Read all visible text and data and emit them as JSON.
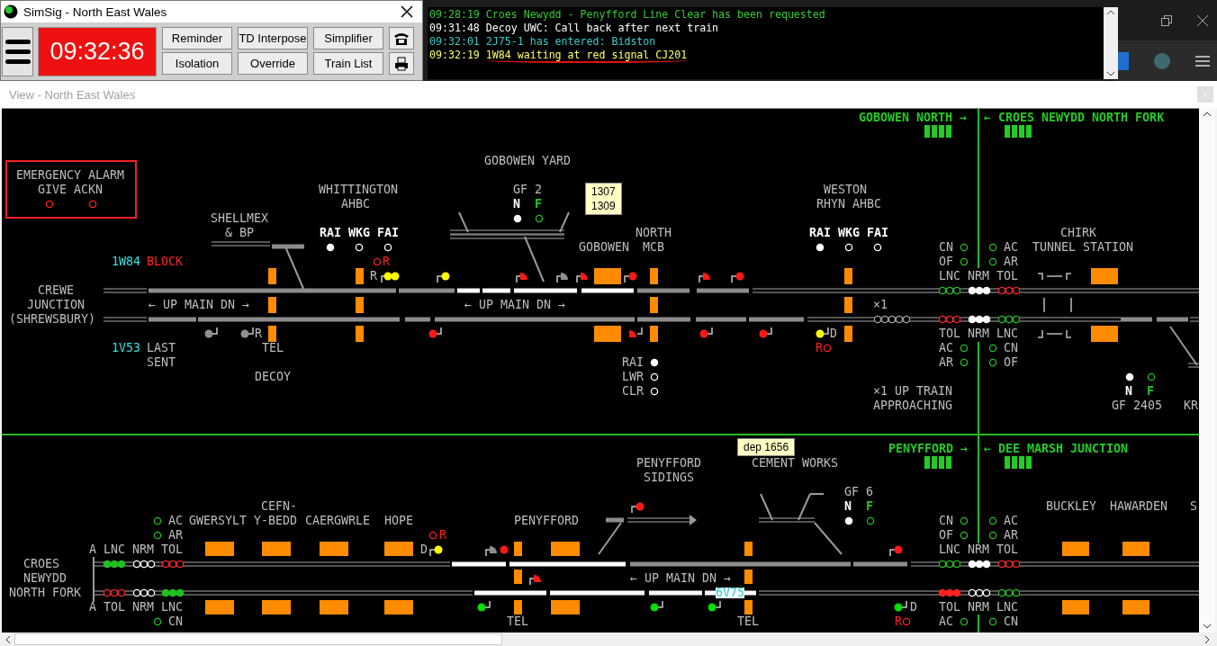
{
  "simsig_window": {
    "title": "SimSig - North East Wales",
    "clock": "09:32:36",
    "buttons": [
      "Reminder",
      "TD Interpose",
      "Simplifier",
      "Isolation",
      "Override",
      "Train List"
    ]
  },
  "message_log": [
    {
      "time": "09:28:19",
      "text": "Croes Newydd - Penyfford Line Clear has been requested",
      "color": "#33cc33",
      "underlined": false
    },
    {
      "time": "09:31:48",
      "text": "Decoy UWC: Call back after next train",
      "color": "#ffffff",
      "underlined": false
    },
    {
      "time": "09:32:01",
      "text": "2J75-1 has entered: Bidston",
      "color": "#33cccc",
      "underlined": false
    },
    {
      "time": "09:32:19",
      "text": "1W84 waiting at red signal CJ201",
      "color": "#ffff66",
      "underlined": true
    }
  ],
  "view_window": {
    "title": "View - North East Wales"
  },
  "diagram": {
    "labels": [
      {
        "text": "GOBOWEN NORTH →",
        "kind": "green"
      },
      {
        "text": "← CROES NEWYDD NORTH FORK",
        "kind": "green"
      },
      {
        "text": "GOBOWEN YARD",
        "kind": "grey"
      },
      {
        "text": "EMERGENCY ALARM",
        "kind": "grey"
      },
      {
        "text": "GIVE ACKN",
        "kind": "grey"
      },
      {
        "text": "WHITTINGTON",
        "kind": "grey"
      },
      {
        "text": "GF 2",
        "kind": "grey"
      },
      {
        "text": "WESTON",
        "kind": "grey"
      },
      {
        "text": "AHBC",
        "kind": "grey"
      },
      {
        "text": "N",
        "kind": "white"
      },
      {
        "text": "F",
        "kind": "green"
      },
      {
        "text": "RHYN AHBC",
        "kind": "grey"
      },
      {
        "text": "SHELLMEX",
        "kind": "grey"
      },
      {
        "text": "& BP",
        "kind": "grey"
      },
      {
        "text": "RAI",
        "kind": "white"
      },
      {
        "text": "WKG",
        "kind": "white"
      },
      {
        "text": "FAI",
        "kind": "white"
      },
      {
        "text": "NORTH",
        "kind": "grey"
      },
      {
        "text": "RAI",
        "kind": "white"
      },
      {
        "text": "WKG",
        "kind": "white"
      },
      {
        "text": "FAI",
        "kind": "white"
      },
      {
        "text": "CHIRK",
        "kind": "grey"
      },
      {
        "text": "GOBOWEN",
        "kind": "grey"
      },
      {
        "text": "MCB",
        "kind": "grey"
      },
      {
        "text": "CN",
        "kind": "grey"
      },
      {
        "text": "AC",
        "kind": "grey"
      },
      {
        "text": "TUNNEL STATION",
        "kind": "grey"
      },
      {
        "text": "1W84",
        "kind": "cyan"
      },
      {
        "text": "BLOCK",
        "kind": "red"
      },
      {
        "text": "R",
        "kind": "red"
      },
      {
        "text": "OF",
        "kind": "grey"
      },
      {
        "text": "AR",
        "kind": "grey"
      },
      {
        "text": "R",
        "kind": "grey"
      },
      {
        "text": "LNC NRM TOL",
        "kind": "grey"
      },
      {
        "text": "CREWE",
        "kind": "grey"
      },
      {
        "text": "JUNCTION",
        "kind": "grey"
      },
      {
        "text": "← UP MAIN DN →",
        "kind": "grey"
      },
      {
        "text": "← UP MAIN DN →",
        "kind": "grey"
      },
      {
        "text": "×1",
        "kind": "grey"
      },
      {
        "text": "(SHREWSBURY)",
        "kind": "grey"
      },
      {
        "text": "R",
        "kind": "grey"
      },
      {
        "text": "D",
        "kind": "grey"
      },
      {
        "text": "TOL NRM LNC",
        "kind": "grey"
      },
      {
        "text": "1V53",
        "kind": "cyan"
      },
      {
        "text": "LAST",
        "kind": "grey"
      },
      {
        "text": "TEL",
        "kind": "grey"
      },
      {
        "text": "R",
        "kind": "red"
      },
      {
        "text": "AC",
        "kind": "grey"
      },
      {
        "text": "CN",
        "kind": "grey"
      },
      {
        "text": "SENT",
        "kind": "grey"
      },
      {
        "text": "RAI",
        "kind": "grey"
      },
      {
        "text": "AR",
        "kind": "grey"
      },
      {
        "text": "OF",
        "kind": "grey"
      },
      {
        "text": "DECOY",
        "kind": "grey"
      },
      {
        "text": "LWR",
        "kind": "grey"
      },
      {
        "text": "CLR",
        "kind": "grey"
      },
      {
        "text": "×1 UP TRAIN",
        "kind": "grey"
      },
      {
        "text": "N",
        "kind": "white"
      },
      {
        "text": "F",
        "kind": "green"
      },
      {
        "text": "APPROACHING",
        "kind": "grey"
      },
      {
        "text": "GF 2405",
        "kind": "grey"
      },
      {
        "text": "KR",
        "kind": "grey"
      },
      {
        "text": "PENYFFORD →",
        "kind": "green"
      },
      {
        "text": "← DEE MARSH JUNCTION",
        "kind": "green"
      },
      {
        "text": "PENYFFORD",
        "kind": "grey"
      },
      {
        "text": "CEMENT WORKS",
        "kind": "grey"
      },
      {
        "text": "SIDINGS",
        "kind": "grey"
      },
      {
        "text": "GF 6",
        "kind": "grey"
      },
      {
        "text": "CEFN-",
        "kind": "grey"
      },
      {
        "text": "N",
        "kind": "white"
      },
      {
        "text": "F",
        "kind": "green"
      },
      {
        "text": "BUCKLEY",
        "kind": "grey"
      },
      {
        "text": "HAWARDEN",
        "kind": "grey"
      },
      {
        "text": "S",
        "kind": "grey"
      },
      {
        "text": "AC",
        "kind": "grey"
      },
      {
        "text": "GWERSYLT",
        "kind": "grey"
      },
      {
        "text": "Y-BEDD",
        "kind": "grey"
      },
      {
        "text": "CAERGWRLE",
        "kind": "grey"
      },
      {
        "text": "HOPE",
        "kind": "grey"
      },
      {
        "text": "PENYFFORD",
        "kind": "grey"
      },
      {
        "text": "CN",
        "kind": "grey"
      },
      {
        "text": "AC",
        "kind": "grey"
      },
      {
        "text": "AR",
        "kind": "grey"
      },
      {
        "text": "R",
        "kind": "red"
      },
      {
        "text": "OF",
        "kind": "grey"
      },
      {
        "text": "AR",
        "kind": "grey"
      },
      {
        "text": "A LNC NRM TOL",
        "kind": "grey"
      },
      {
        "text": "D",
        "kind": "grey"
      },
      {
        "text": "LNC NRM TOL",
        "kind": "grey"
      },
      {
        "text": "CROES",
        "kind": "grey"
      },
      {
        "text": "NEWYDD",
        "kind": "grey"
      },
      {
        "text": "← UP MAIN DN →",
        "kind": "grey"
      },
      {
        "text": "NORTH FORK",
        "kind": "grey"
      },
      {
        "text": "6V75",
        "kind": "cyan_on_track"
      },
      {
        "text": "A TOL NRM LNC",
        "kind": "grey"
      },
      {
        "text": "D",
        "kind": "grey"
      },
      {
        "text": "TOL NRM LNC",
        "kind": "grey"
      },
      {
        "text": "CN",
        "kind": "grey"
      },
      {
        "text": "TEL",
        "kind": "grey"
      },
      {
        "text": "TEL",
        "kind": "grey"
      },
      {
        "text": "R",
        "kind": "red"
      },
      {
        "text": "AC",
        "kind": "grey"
      },
      {
        "text": "CN",
        "kind": "grey"
      }
    ],
    "lamps": [
      {
        "color": "#ff2020",
        "lit": false
      },
      {
        "color": "#ff2020",
        "lit": false
      },
      {
        "color": "#ffffff",
        "lit": true
      },
      {
        "color": "#ffffff",
        "lit": false
      },
      {
        "color": "#ffffff",
        "lit": false
      },
      {
        "color": "#ff2020",
        "lit": false
      },
      {
        "color": "#ffffff",
        "lit": true
      },
      {
        "color": "#20c020",
        "lit": false
      },
      {
        "color": "#ffffff",
        "lit": true
      },
      {
        "color": "#ffffff",
        "lit": false
      },
      {
        "color": "#ffffff",
        "lit": false
      },
      {
        "color": "#ffffff",
        "lit": true
      },
      {
        "color": "#ffffff",
        "lit": false
      },
      {
        "color": "#ffffff",
        "lit": false
      },
      {
        "color": "#ff2020",
        "lit": false
      },
      {
        "color": "#a0a0a0",
        "lit": false
      },
      {
        "color": "#a0a0a0",
        "lit": false
      },
      {
        "color": "#a0a0a0",
        "lit": false
      },
      {
        "color": "#a0a0a0",
        "lit": false
      },
      {
        "color": "#a0a0a0",
        "lit": false
      },
      {
        "color": "#20c020",
        "lit": false
      },
      {
        "color": "#20c020",
        "lit": false
      },
      {
        "color": "#20c020",
        "lit": false
      },
      {
        "color": "#20c020",
        "lit": false
      },
      {
        "color": "#20c020",
        "lit": false
      },
      {
        "color": "#20c020",
        "lit": false
      },
      {
        "color": "#20c020",
        "lit": false
      },
      {
        "color": "#ffffff",
        "lit": true
      },
      {
        "color": "#ffffff",
        "lit": true
      },
      {
        "color": "#ffffff",
        "lit": true
      },
      {
        "color": "#ff2020",
        "lit": false
      },
      {
        "color": "#ff2020",
        "lit": false
      },
      {
        "color": "#ff2020",
        "lit": false
      },
      {
        "color": "#ff2020",
        "lit": false
      },
      {
        "color": "#ff2020",
        "lit": false
      },
      {
        "color": "#ff2020",
        "lit": false
      },
      {
        "color": "#ffffff",
        "lit": true
      },
      {
        "color": "#ffffff",
        "lit": true
      },
      {
        "color": "#ffffff",
        "lit": true
      },
      {
        "color": "#20c020",
        "lit": false
      },
      {
        "color": "#20c020",
        "lit": false
      },
      {
        "color": "#20c020",
        "lit": false
      },
      {
        "color": "#20c020",
        "lit": false
      },
      {
        "color": "#20c020",
        "lit": false
      },
      {
        "color": "#20c020",
        "lit": false
      },
      {
        "color": "#20c020",
        "lit": false
      },
      {
        "color": "#ffffff",
        "lit": true
      },
      {
        "color": "#20c020",
        "lit": false
      },
      {
        "color": "#ffffff",
        "lit": true
      },
      {
        "color": "#20c020",
        "lit": false
      },
      {
        "color": "#20c020",
        "lit": false
      },
      {
        "color": "#20c020",
        "lit": false
      },
      {
        "color": "#20c020",
        "lit": false
      },
      {
        "color": "#20c020",
        "lit": false
      },
      {
        "color": "#20c020",
        "lit": false
      },
      {
        "color": "#20c020",
        "lit": false
      },
      {
        "color": "#20c020",
        "lit": false
      },
      {
        "color": "#ffffff",
        "lit": true
      },
      {
        "color": "#ffffff",
        "lit": true
      },
      {
        "color": "#ffffff",
        "lit": true
      },
      {
        "color": "#ff2020",
        "lit": false
      },
      {
        "color": "#ff2020",
        "lit": false
      },
      {
        "color": "#ff2020",
        "lit": false
      },
      {
        "color": "#ff2020",
        "lit": true
      },
      {
        "color": "#ff2020",
        "lit": true
      },
      {
        "color": "#ff2020",
        "lit": true
      },
      {
        "color": "#ffffff",
        "lit": false
      },
      {
        "color": "#ffffff",
        "lit": false
      },
      {
        "color": "#ffffff",
        "lit": false
      },
      {
        "color": "#20c020",
        "lit": false
      },
      {
        "color": "#20c020",
        "lit": false
      },
      {
        "color": "#20c020",
        "lit": false
      },
      {
        "color": "#20c020",
        "lit": false
      },
      {
        "color": "#20c020",
        "lit": false
      },
      {
        "color": "#ff2020",
        "lit": false
      },
      {
        "color": "#20c020",
        "lit": false
      },
      {
        "color": "#20c020",
        "lit": false
      },
      {
        "color": "#20c020",
        "lit": false
      },
      {
        "color": "#ff2020",
        "lit": false
      },
      {
        "color": "#20c020",
        "lit": true
      },
      {
        "color": "#20c020",
        "lit": true
      },
      {
        "color": "#20c020",
        "lit": true
      },
      {
        "color": "#ffffff",
        "lit": false
      },
      {
        "color": "#ffffff",
        "lit": false
      },
      {
        "color": "#ffffff",
        "lit": false
      },
      {
        "color": "#ff2020",
        "lit": false
      },
      {
        "color": "#ff2020",
        "lit": false
      },
      {
        "color": "#ff2020",
        "lit": false
      },
      {
        "color": "#ff2020",
        "lit": false
      },
      {
        "color": "#ff2020",
        "lit": false
      },
      {
        "color": "#ff2020",
        "lit": false
      },
      {
        "color": "#ffffff",
        "lit": false
      },
      {
        "color": "#ffffff",
        "lit": false
      },
      {
        "color": "#ffffff",
        "lit": false
      },
      {
        "color": "#20c020",
        "lit": true
      },
      {
        "color": "#20c020",
        "lit": true
      },
      {
        "color": "#20c020",
        "lit": true
      }
    ],
    "signals": [
      {
        "kind": "double",
        "color": "#ffff00"
      },
      {
        "kind": "main",
        "color": "#ffff00"
      },
      {
        "kind": "shunt",
        "color": "#ff1818"
      },
      {
        "kind": "shunt",
        "color": "#909090"
      },
      {
        "kind": "shunt",
        "color": "#ff1818"
      },
      {
        "kind": "main",
        "color": "#ff1818"
      },
      {
        "kind": "shunt",
        "color": "#ff1818"
      },
      {
        "kind": "main",
        "color": "#ff1818"
      },
      {
        "kind": "main",
        "color": "#909090"
      },
      {
        "kind": "main",
        "color": "#909090"
      },
      {
        "kind": "main",
        "color": "#ff1818"
      },
      {
        "kind": "shunt",
        "color": "#ff1818"
      },
      {
        "kind": "main",
        "color": "#ff1818"
      },
      {
        "kind": "main",
        "color": "#ff1818"
      },
      {
        "kind": "main",
        "color": "#ffff00"
      },
      {
        "kind": "main",
        "color": "#ffff00"
      },
      {
        "kind": "shunt",
        "color": "#909090"
      },
      {
        "kind": "main",
        "color": "#ff1818"
      },
      {
        "kind": "shunt",
        "color": "#ff1818"
      },
      {
        "kind": "main",
        "color": "#ff1818"
      },
      {
        "kind": "main",
        "color": "#ff1818"
      },
      {
        "kind": "main",
        "color": "#00dd00"
      },
      {
        "kind": "main",
        "color": "#00dd00"
      },
      {
        "kind": "main",
        "color": "#00dd00"
      },
      {
        "kind": "main",
        "color": "#00dd00"
      }
    ],
    "track_circuits": [
      {
        "route_set": false
      },
      {
        "route_set": false
      },
      {
        "route_set": true
      },
      {
        "route_set": true
      },
      {
        "route_set": true
      },
      {
        "route_set": true
      },
      {
        "route_set": false
      },
      {
        "route_set": false
      },
      {
        "route_set": false
      },
      {
        "route_set": false
      },
      {
        "route_set": false
      },
      {
        "route_set": false
      },
      {
        "route_set": false
      },
      {
        "route_set": false
      },
      {
        "route_set": false
      },
      {
        "route_set": false
      },
      {
        "route_set": false
      },
      {
        "route_set": false
      },
      {
        "route_set": true
      },
      {
        "route_set": true
      },
      {
        "route_set": false
      },
      {
        "route_set": false
      },
      {
        "route_set": true
      },
      {
        "route_set": true
      },
      {
        "route_set": true
      },
      {
        "route_set": true
      },
      {
        "route_set": false
      }
    ],
    "tooltips": [
      {
        "lines": [
          "1307",
          "1309"
        ]
      },
      {
        "lines": [
          "dep 1656"
        ]
      }
    ]
  }
}
